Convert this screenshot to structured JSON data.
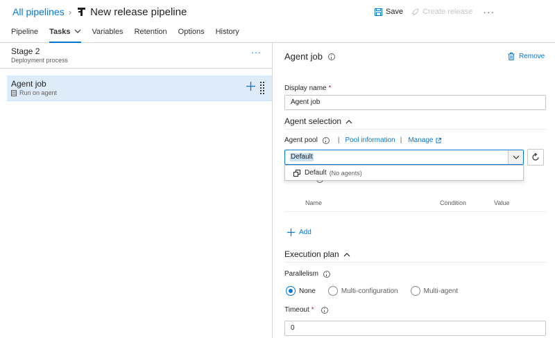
{
  "header": {
    "breadcrumb_root": "All pipelines",
    "title": "New release pipeline",
    "save_label": "Save",
    "create_release_label": "Create release",
    "more_label": "···"
  },
  "tabs": [
    {
      "label": "Pipeline"
    },
    {
      "label": "Tasks",
      "active": true
    },
    {
      "label": "Variables"
    },
    {
      "label": "Retention"
    },
    {
      "label": "Options"
    },
    {
      "label": "History"
    }
  ],
  "stage": {
    "name": "Stage 2",
    "subtitle": "Deployment process",
    "more_label": "···"
  },
  "job": {
    "name": "Agent job",
    "subtitle": "Run on agent"
  },
  "detail": {
    "title": "Agent job",
    "remove_label": "Remove",
    "display_name_label": "Display name",
    "required_mark": "*",
    "display_name_value": "Agent job",
    "agent_selection_label": "Agent selection",
    "agent_pool_label": "Agent pool",
    "pool_information_label": "Pool information",
    "manage_label": "Manage",
    "pool_selected": "Default",
    "dropdown_option": "Default",
    "dropdown_option_note": "(No agents)",
    "demands_columns": [
      "Name",
      "Condition",
      "Value"
    ],
    "add_label": "Add",
    "execution_plan_label": "Execution plan",
    "parallelism_label": "Parallelism",
    "parallelism_options": [
      "None",
      "Multi-configuration",
      "Multi-agent"
    ],
    "parallelism_selected": "None",
    "timeout_label": "Timeout",
    "timeout_value": "0"
  },
  "colors": {
    "accent": "#0078d4",
    "selected_row": "#deecf9",
    "required": "#a4262c"
  }
}
